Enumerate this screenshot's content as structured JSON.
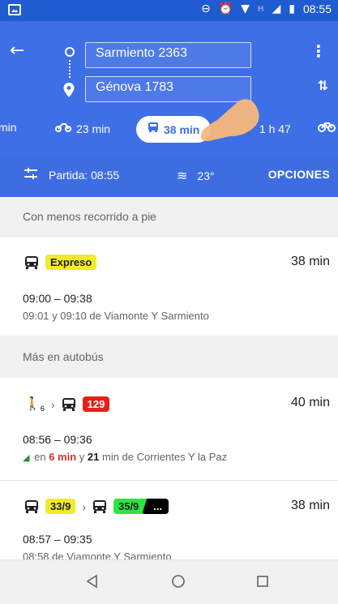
{
  "status_bar": {
    "time": "08:55",
    "network_h": "H"
  },
  "header": {
    "origin": "Sarmiento 2363",
    "destination": "Génova 1783"
  },
  "modes": [
    {
      "icon": "car-icon",
      "label": "min"
    },
    {
      "icon": "motorcycle-icon",
      "label": "23 min"
    },
    {
      "icon": "bus-icon",
      "label": "38 min",
      "selected": true
    },
    {
      "icon": "walk-icon",
      "label": "1 h 47"
    },
    {
      "icon": "bike-icon",
      "label": ""
    }
  ],
  "options_bar": {
    "departure": "Partida: 08:55",
    "temperature": "23°",
    "options_label": "OPCIONES"
  },
  "sections": {
    "less_walking": "Con menos recorrido a pie",
    "more_bus": "Más en autobús"
  },
  "routes": [
    {
      "chips": [
        "Expreso"
      ],
      "duration": "38 min",
      "times": "09:00 – 09:38",
      "description": "09:01 y 09:10 de Viamonte Y Sarmiento"
    },
    {
      "walk_minutes": "6",
      "chips": [
        "129"
      ],
      "duration": "40 min",
      "times": "08:56 – 09:36",
      "desc_prefix": "en",
      "desc_first": "6 min",
      "desc_mid": "y",
      "desc_second": "21",
      "desc_suffix": "min de Corrientes Y la Paz"
    },
    {
      "chips": [
        "33/9",
        "35/9",
        "..."
      ],
      "duration": "38 min",
      "times": "08:57 – 09:35",
      "description": "08:58 de Viamonte Y Sarmiento"
    }
  ],
  "colors": {
    "header_blue": "#3f6fe6",
    "status_blue": "#1f5bd1",
    "chip_yellow": "#f2ea2c",
    "chip_red": "#e2231a",
    "chip_green": "#2fe43f"
  }
}
